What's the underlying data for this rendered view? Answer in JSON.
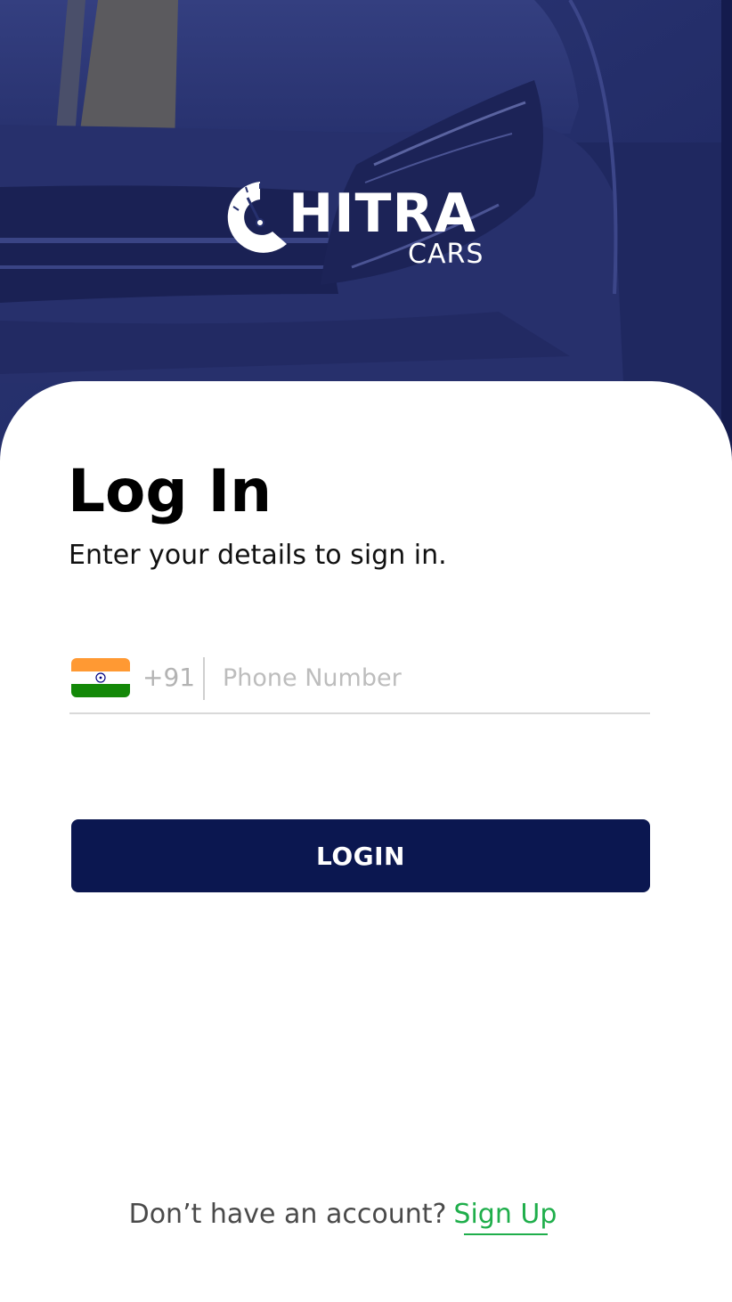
{
  "brand": {
    "name": "CHITRA",
    "name_rest": "HITRA",
    "tagline": "CARS"
  },
  "login": {
    "title": "Log In",
    "subtitle": "Enter your details to sign in."
  },
  "phone": {
    "country_flag": "india-flag-icon",
    "country_code": "+91",
    "placeholder": "Phone Number",
    "value": ""
  },
  "actions": {
    "login_label": "LOGIN"
  },
  "footer": {
    "prompt": "Don’t have an account?",
    "signup_label": "Sign Up"
  },
  "colors": {
    "hero_overlay": "#26306e",
    "primary": "#0b1750",
    "link": "#1fae4b",
    "placeholder": "#bdbdbd"
  }
}
